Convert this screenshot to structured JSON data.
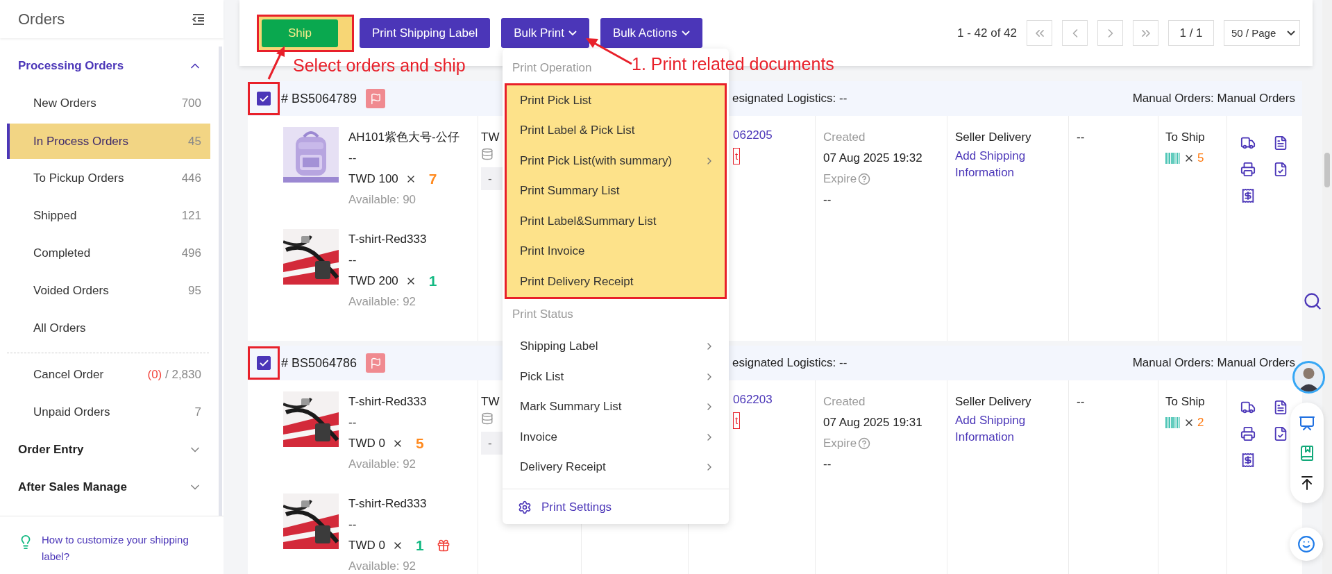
{
  "sidebar": {
    "title": "Orders",
    "sections": [
      {
        "label": "Processing Orders",
        "expanded": true,
        "groups": [
          [
            {
              "label": "New Orders",
              "count": "700",
              "selected": false
            },
            {
              "label": "In Process Orders",
              "count": "45",
              "selected": true
            },
            {
              "label": "To Pickup Orders",
              "count": "446",
              "selected": false
            },
            {
              "label": "Shipped",
              "count": "121",
              "selected": false
            },
            {
              "label": "Completed",
              "count": "496",
              "selected": false
            },
            {
              "label": "Voided Orders",
              "count": "95",
              "selected": false
            },
            {
              "label": "All Orders",
              "selected": false
            }
          ],
          [
            {
              "label": "Cancel Order",
              "alert": "(0)",
              "count": "/ 2,830",
              "selected": false
            },
            {
              "label": "Unpaid Orders",
              "count": "7",
              "selected": false
            }
          ]
        ]
      },
      {
        "label": "Order Entry",
        "expanded": false
      },
      {
        "label": "After Sales Manage",
        "expanded": false
      }
    ],
    "tip": "How to customize your shipping label?"
  },
  "toolbar": {
    "buttons": [
      {
        "label": "Ship",
        "kind": "ship",
        "highlighted": true
      },
      {
        "label": "Print Shipping Label",
        "kind": "plain",
        "highlighted": false
      },
      {
        "label": "Bulk Print",
        "kind": "menu",
        "highlighted": false
      },
      {
        "label": "Bulk Actions",
        "kind": "menu",
        "highlighted": false
      }
    ],
    "pagination": {
      "range": "1 - 42 of 42",
      "page": "1 / 1",
      "page_size": "50 / Page"
    }
  },
  "print_menu": {
    "sections": [
      {
        "title": "Print Operation",
        "highlighted": true,
        "items": [
          {
            "label": "Print Pick List",
            "submenu": false
          },
          {
            "label": "Print Label & Pick List",
            "submenu": false
          },
          {
            "label": "Print Pick List(with summary)",
            "submenu": true
          },
          {
            "label": "Print Summary List",
            "submenu": false
          },
          {
            "label": "Print Label&Summary List",
            "submenu": false
          },
          {
            "label": "Print Invoice",
            "submenu": false
          },
          {
            "label": "Print Delivery Receipt",
            "submenu": false
          }
        ]
      },
      {
        "title": "Print Status",
        "highlighted": false,
        "items": [
          {
            "label": "Shipping Label",
            "submenu": true
          },
          {
            "label": "Pick List",
            "submenu": true
          },
          {
            "label": "Mark Summary List",
            "submenu": true
          },
          {
            "label": "Invoice",
            "submenu": true
          },
          {
            "label": "Delivery Receipt",
            "submenu": true
          }
        ]
      }
    ],
    "settings": "Print Settings"
  },
  "orders": [
    {
      "number": "# BS5064789",
      "selected": true,
      "annotated": true,
      "logistics": "esignated Logistics: --",
      "source": "Manual Orders: Manual Orders",
      "products": [
        {
          "name": "AH101紫色大号-公仔",
          "variant": "--",
          "price": "TWD 100",
          "qty": "7",
          "color": "#ff8a1f",
          "gift": false,
          "available": "Available: 90"
        },
        {
          "name": "T-shirt-Red333",
          "variant": "--",
          "price": "TWD 200",
          "qty": "1",
          "color": "#13b982",
          "gift": false,
          "available": "Available: 92"
        }
      ],
      "amount": "TW",
      "amount_box": "-",
      "reference": "062205",
      "reference_tag": "t",
      "created_label": "Created",
      "created": "07 Aug 2025 19:32",
      "expire_label": "Expire",
      "expire": "--",
      "shipping": "Seller Delivery",
      "shipping_link": "Add Shipping Information",
      "column_7": "--",
      "status": "To Ship",
      "units": "5"
    },
    {
      "number": "# BS5064786",
      "selected": true,
      "annotated": true,
      "logistics": "esignated Logistics: --",
      "source": "Manual Orders: Manual Orders",
      "products": [
        {
          "name": "T-shirt-Red333",
          "variant": "--",
          "price": "TWD 0",
          "qty": "5",
          "color": "#ff8a1f",
          "gift": false,
          "available": "Available: 92"
        },
        {
          "name": "T-shirt-Red333",
          "variant": "--",
          "price": "TWD 0",
          "qty": "1",
          "color": "#13b982",
          "gift": true,
          "available": "Available: 92"
        }
      ],
      "amount": "TW",
      "amount_box": "-",
      "reference": "062203",
      "reference_tag": "t",
      "created_label": "Created",
      "created": "07 Aug 2025 19:31",
      "expire_label": "Expire",
      "expire": "--",
      "shipping": "Seller Delivery",
      "shipping_link": "Add Shipping Information",
      "column_7": "--",
      "status": "To Ship",
      "units": "2"
    }
  ],
  "annotations": [
    {
      "text": "Select orders and ship"
    },
    {
      "text": "1. Print related documents"
    }
  ]
}
